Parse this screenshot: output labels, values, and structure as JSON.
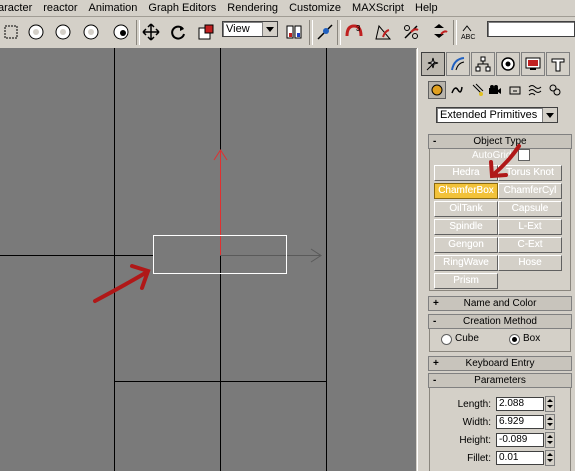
{
  "menu": [
    "aracter",
    "reactor",
    "Animation",
    "Graph Editors",
    "Rendering",
    "Customize",
    "MAXScript",
    "Help"
  ],
  "toolbar": {
    "view_dropdown": "View",
    "icons": [
      "select-icon",
      "circle-select-icon",
      "circle-select-icon-2",
      "circle-select-icon-3",
      "select-by-name-icon",
      "move-icon",
      "rotate-icon",
      "scale-icon",
      "mirror-icon",
      "snap-icon",
      "angle-snap-icon",
      "percent-snap-icon",
      "spinner-snap-icon",
      "named-selection-icon"
    ]
  },
  "command_panel": {
    "category_dropdown": "Extended Primitives",
    "object_type": {
      "header": "Object Type",
      "autogrid_label": "AutoGrid",
      "buttons": [
        "Hedra",
        "Torus Knot",
        "ChamferBox",
        "ChamferCyl",
        "OilTank",
        "Capsule",
        "Spindle",
        "L-Ext",
        "Gengon",
        "C-Ext",
        "RingWave",
        "Hose",
        "Prism"
      ],
      "active_button": "ChamferBox"
    },
    "name_and_color": {
      "header": "Name and Color"
    },
    "creation_method": {
      "header": "Creation Method",
      "options": [
        "Cube",
        "Box"
      ],
      "selected": "Box"
    },
    "keyboard_entry": {
      "header": "Keyboard Entry"
    },
    "parameters": {
      "header": "Parameters",
      "fields": [
        {
          "label": "Length:",
          "value": "2.088"
        },
        {
          "label": "Width:",
          "value": "6.929"
        },
        {
          "label": "Height:",
          "value": "-0.089"
        },
        {
          "label": "Fillet:",
          "value": "0.01"
        }
      ]
    }
  },
  "colors": {
    "viewport_bg": "#7a7a7a",
    "grid_line": "#000000",
    "axis_y": "#e03030",
    "active_button": "#f2c23a",
    "annotation_arrow": "#b01818"
  }
}
